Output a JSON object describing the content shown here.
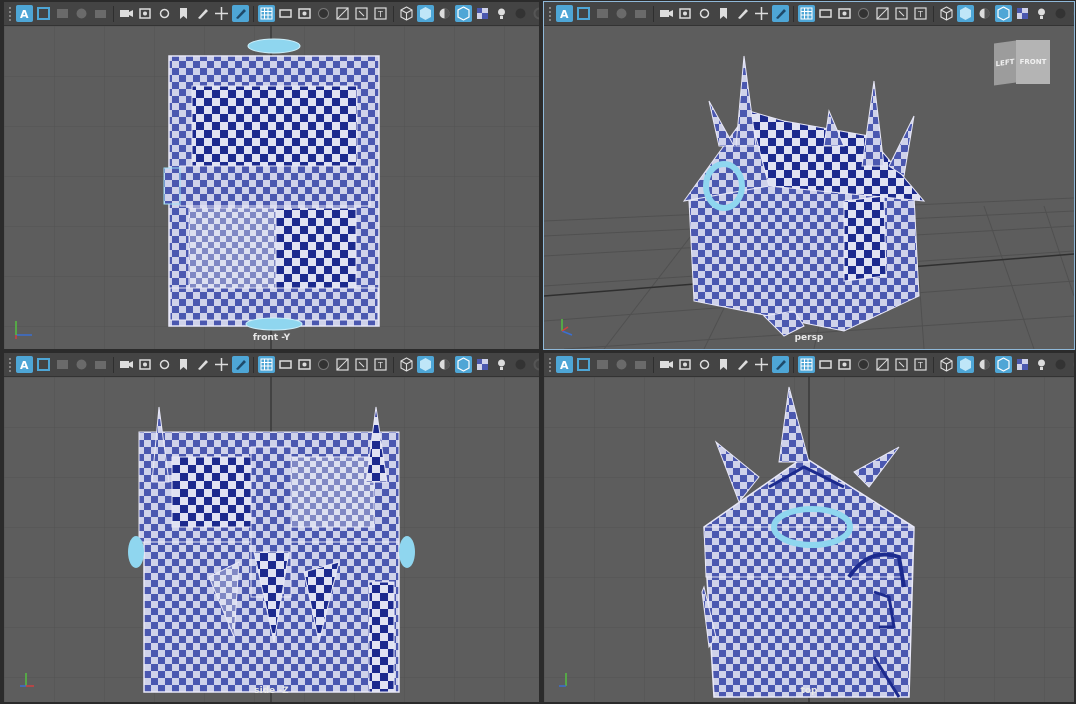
{
  "toolbar": {
    "icons": [
      "camera-attr-icon",
      "select-camera-icon",
      "camera-tools-icon",
      "image-plane-icon",
      "film-gate-icon",
      "gate-mask-icon",
      "bookmark-icon",
      "grease-pencil-icon",
      "two-d-pan-icon",
      "wireframe-icon",
      "grid-toggle-icon",
      "film-gate-toggle-icon",
      "resolution-gate-icon",
      "gate-mask-toggle-icon",
      "field-chart-icon",
      "safe-action-icon",
      "safe-title-icon",
      "wireframe-shading-icon",
      "smooth-shade-icon",
      "default-material-icon",
      "wireframe-on-shaded-icon",
      "textured-icon",
      "use-all-lights-icon",
      "shadows-icon",
      "ambient-occlusion-icon"
    ]
  },
  "viewports": [
    {
      "label": "front -Y",
      "axis_labels": [
        "z",
        "y",
        "x"
      ]
    },
    {
      "label": "persp",
      "axis_labels": [
        "y",
        "z"
      ]
    },
    {
      "label": "side -Z",
      "axis_labels": [
        "y",
        "z",
        "x"
      ]
    },
    {
      "label": "top",
      "axis_labels": [
        "y",
        "z"
      ]
    }
  ],
  "view_cube": {
    "left": "LEFT",
    "front": "FRONT"
  },
  "colors": {
    "viewport_bg": "#5d5d5d",
    "checker_dark": "#1a2a8c",
    "checker_light": "#c8cce8",
    "highlight": "#7fd0ee"
  }
}
